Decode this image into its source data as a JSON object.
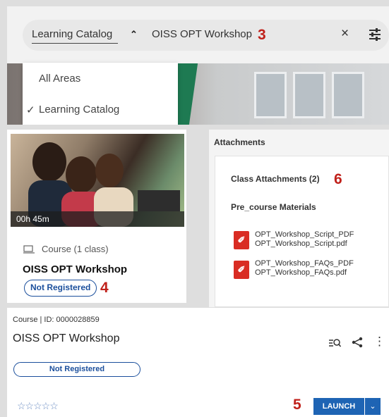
{
  "search": {
    "scope_selected": "Learning Catalog",
    "query": "OISS OPT Workshop",
    "clear_icon": "×",
    "scope_options": [
      "All Areas",
      "Learning Catalog"
    ],
    "selected_check": "✓"
  },
  "callouts": {
    "c3": "3",
    "c4": "4",
    "c5": "5",
    "c6": "6"
  },
  "course_card": {
    "duration": "00h 45m",
    "type_label": "Course (1 class)",
    "title": "OISS OPT Workshop",
    "status": "Not Registered"
  },
  "attachments": {
    "header": "Attachments",
    "section_title": "Class Attachments (2)",
    "group_title": "Pre_course Materials",
    "files": [
      {
        "name": "OPT_Workshop_Script_PDF",
        "file": "OPT_Workshop_Script.pdf"
      },
      {
        "name": "OPT_Workshop_FAQs_PDF",
        "file": "OPT_Workshop_FAQs.pdf"
      }
    ]
  },
  "detail": {
    "meta": "Course  |  ID: 0000028859",
    "title": "OISS OPT Workshop",
    "status": "Not Registered",
    "stars": "☆☆☆☆☆",
    "launch_label": "LAUNCH",
    "more_icon": "⋮",
    "dropdown_icon": "⌄"
  },
  "colors": {
    "accent": "#1e64b4",
    "callout": "#c0211b",
    "pdf": "#d92c23"
  }
}
